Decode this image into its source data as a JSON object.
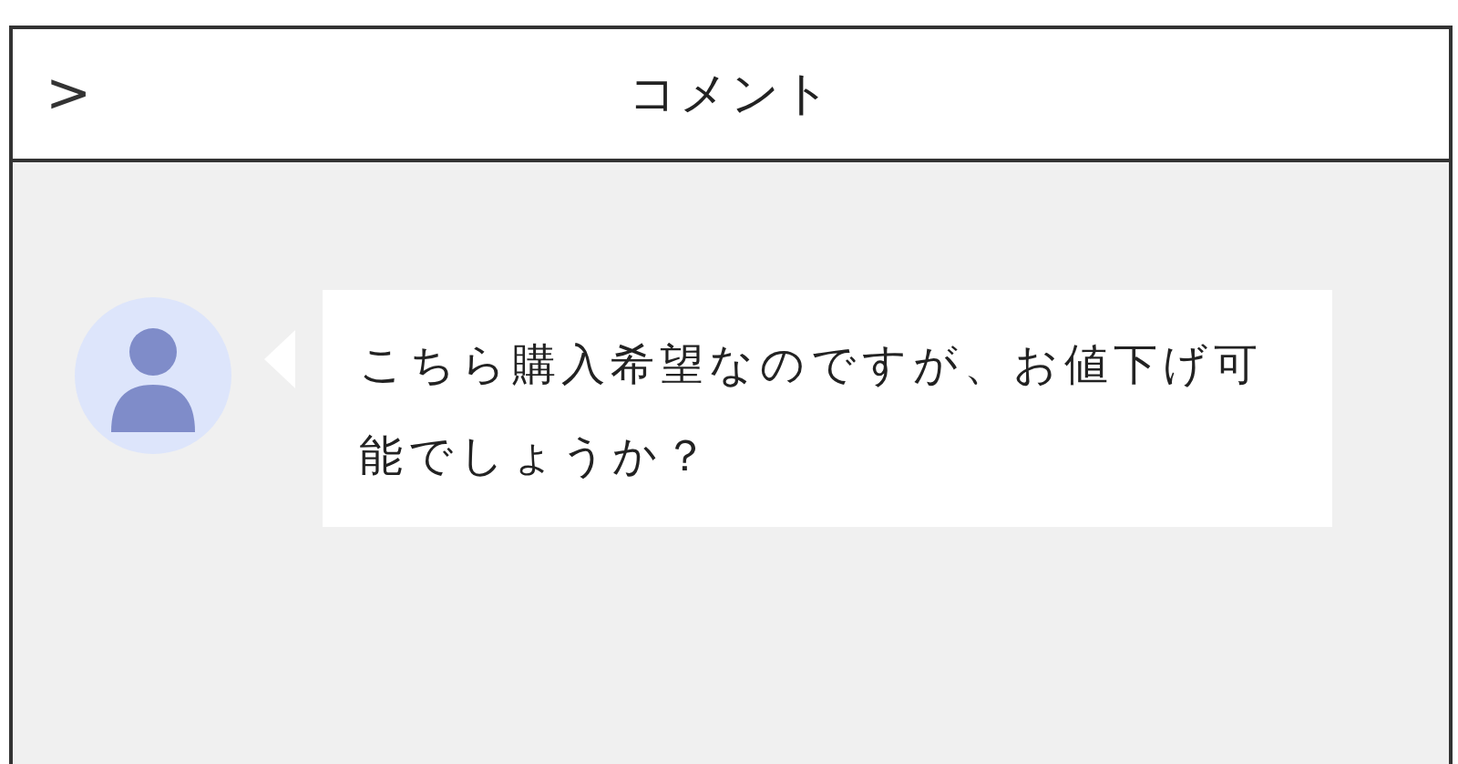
{
  "header": {
    "back": ">",
    "title": "コメント"
  },
  "comments": [
    {
      "text": "こちら購入希望なのですが、お値下げ可能でしょうか？"
    }
  ]
}
